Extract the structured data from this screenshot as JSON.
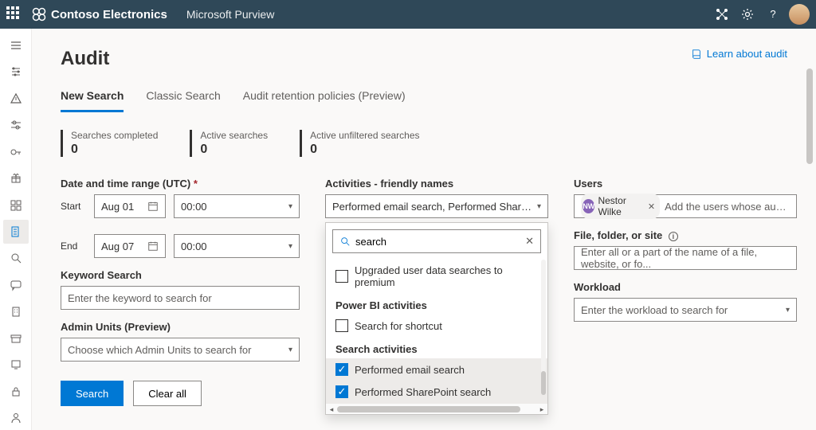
{
  "top": {
    "org": "Contoso Electronics",
    "product": "Microsoft Purview"
  },
  "page": {
    "title": "Audit",
    "learn": "Learn about audit"
  },
  "tabs": [
    {
      "label": "New Search",
      "active": true
    },
    {
      "label": "Classic Search",
      "active": false
    },
    {
      "label": "Audit retention policies (Preview)",
      "active": false
    }
  ],
  "stats": {
    "completed_label": "Searches completed",
    "completed": "0",
    "active_label": "Active searches",
    "active": "0",
    "unfiltered_label": "Active unfiltered searches",
    "unfiltered": "0"
  },
  "form": {
    "date_label": "Date and time range (UTC)",
    "start_label": "Start",
    "start_date": "Aug 01",
    "start_time": "00:00",
    "end_label": "End",
    "end_date": "Aug 07",
    "end_time": "00:00",
    "keyword_label": "Keyword Search",
    "keyword_placeholder": "Enter the keyword to search for",
    "admin_label": "Admin Units (Preview)",
    "admin_placeholder": "Choose which Admin Units to search for",
    "activities_label": "Activities - friendly names",
    "activities_value": "Performed email search, Performed SharePoint se...",
    "users_label": "Users",
    "user_chip_initials": "NW",
    "user_chip_name": "Nestor Wilke",
    "users_placeholder": "Add the users whose audit lo...",
    "file_label": "File, folder, or site",
    "file_placeholder": "Enter all or a part of the name of a file, website, or fo...",
    "workload_label": "Workload",
    "workload_placeholder": "Enter the workload to search for",
    "search_btn": "Search",
    "clear_btn": "Clear all"
  },
  "dropdown": {
    "search_value": "search",
    "row_upgraded": "Upgraded user data searches to premium",
    "group_powerbi": "Power BI activities",
    "row_shortcut": "Search for shortcut",
    "group_search": "Search activities",
    "row_email": "Performed email search",
    "row_sharepoint": "Performed SharePoint search"
  }
}
